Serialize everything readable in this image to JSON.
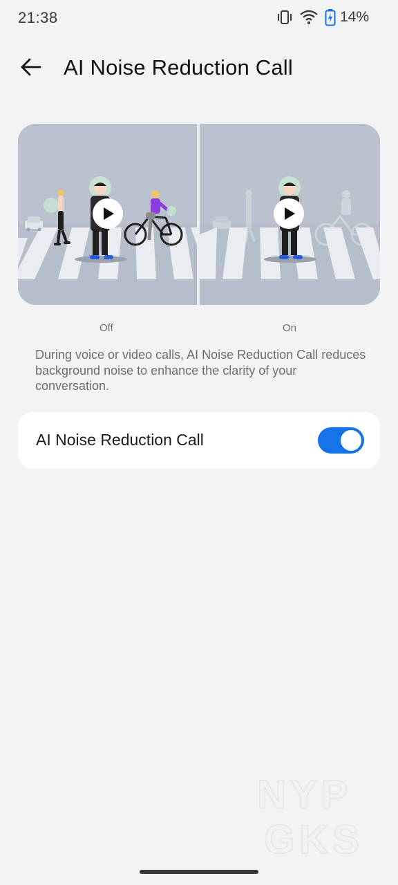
{
  "status_bar": {
    "time": "21:38",
    "battery_percent": "14%",
    "icons": [
      "vibrate-icon",
      "wifi-icon",
      "battery-charging-icon"
    ]
  },
  "header": {
    "title": "AI Noise Reduction Call",
    "back_icon": "arrow-left-icon"
  },
  "demo": {
    "off_caption": "Off",
    "on_caption": "On",
    "play_icon": "play-icon"
  },
  "description": "During voice or video calls, AI Noise Reduction Call reduces background noise to enhance the clarity of your conversation.",
  "setting": {
    "label": "AI Noise Reduction Call",
    "enabled": true,
    "accent_color": "#1572e8"
  },
  "watermark": "NYP GKS"
}
